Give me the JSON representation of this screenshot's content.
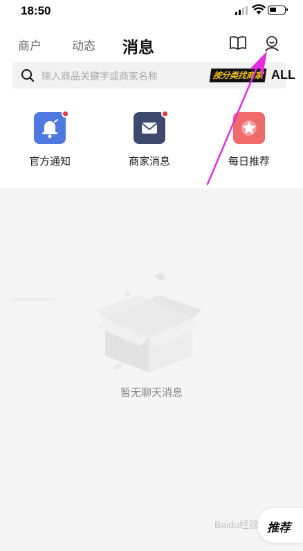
{
  "status_bar": {
    "time": "18:50"
  },
  "header": {
    "tabs": [
      {
        "label": "商户"
      },
      {
        "label": "动态"
      },
      {
        "label": "消息"
      }
    ],
    "icons": [
      "book-icon",
      "profile-icon"
    ]
  },
  "search": {
    "placeholder": "输入商品关键字或商家名称",
    "promo_text": "按分类找商家",
    "promo_all": "ALL"
  },
  "entries": [
    {
      "label": "官方通知",
      "icon": "bell-icon",
      "color": "#4f79e0",
      "has_dot": true
    },
    {
      "label": "商家消息",
      "icon": "mail-icon",
      "color": "#3e4a6d",
      "has_dot": true
    },
    {
      "label": "每日推荐",
      "icon": "star-icon",
      "color": "#ef6b6b",
      "has_dot": false
    }
  ],
  "empty_state": {
    "message": "暂无聊天消息",
    "icon": "empty-box-icon"
  },
  "floating_button": {
    "label": "推荐"
  },
  "watermark": "Baidu经验",
  "annotation": {
    "color": "#e62be0"
  }
}
